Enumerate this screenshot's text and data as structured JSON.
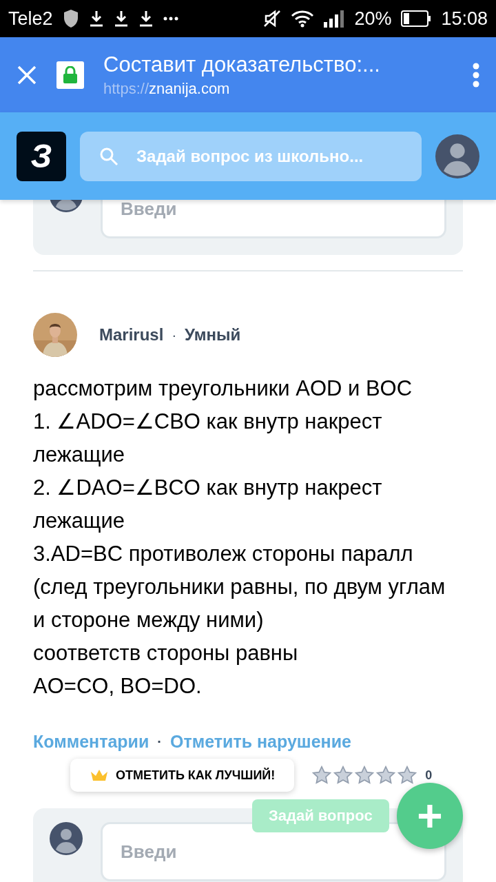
{
  "status_bar": {
    "carrier": "Tele2",
    "battery": "20%",
    "time": "15:08"
  },
  "browser_bar": {
    "title": "Составит доказательство:...",
    "url_scheme": "https://",
    "url_host": "znanija.com"
  },
  "site_header": {
    "logo": "З",
    "search": {
      "placeholder": "Задай вопрос из школьно..."
    }
  },
  "top_comment": {
    "placeholder": "Введи"
  },
  "answer": {
    "author": "Marirusl",
    "separator": "·",
    "rank": "Умный",
    "paragraphs": [
      "рассмотрим треугольники AOD и BOC",
      "1.  ∠ADO=∠CBO как внутр накрест лежащие",
      "2.   ∠DAO=∠BCO как внутр накрест лежащие",
      "3.AD=BC противолеж стороны паралл",
      "(след треугольники равны, по двум углам и стороне между ними)",
      "соответств стороны равны",
      "AO=CO, BO=DO."
    ],
    "links": [
      {
        "label": "Комментарии"
      },
      {
        "label": "Отметить нарушение"
      }
    ],
    "link_separator": "·",
    "best_button": "ОТМЕТИТЬ КАК ЛУЧШИЙ!",
    "rating": {
      "stars": 0,
      "count": "0"
    }
  },
  "bottom_comment": {
    "placeholder": "Введи"
  },
  "ask_button": {
    "label": "Задай вопрос",
    "icon": "+"
  }
}
